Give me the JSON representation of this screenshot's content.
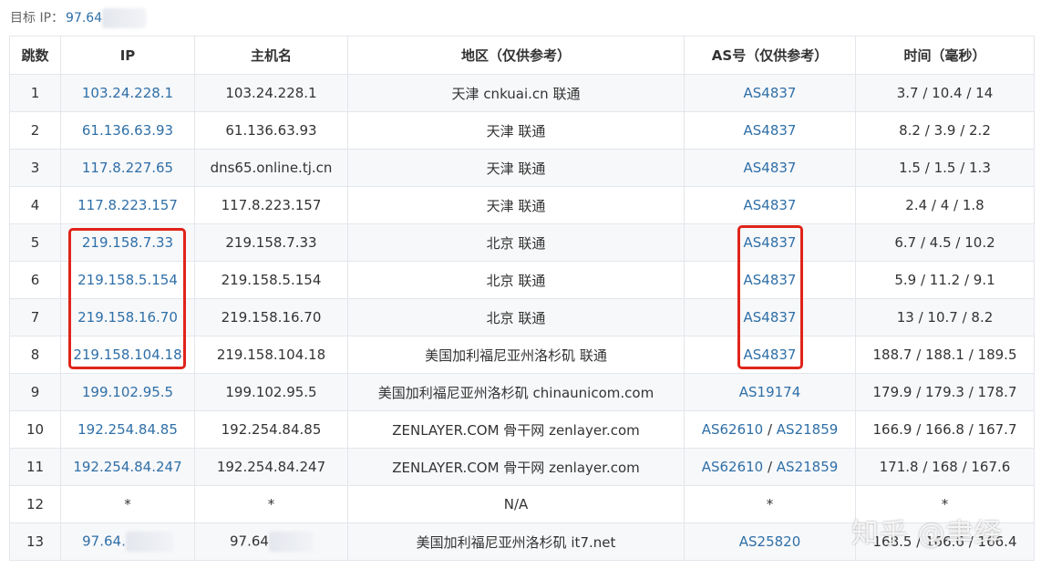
{
  "target": {
    "label": "目标 IP：",
    "ip_visible": "97.64"
  },
  "headers": [
    "跳数",
    "IP",
    "主机名",
    "地区（仅供参考）",
    "AS号（仅供参考）",
    "时间（毫秒）"
  ],
  "rows": [
    {
      "hop": "1",
      "ip": "103.24.228.1",
      "host": "103.24.228.1",
      "region": "天津 cnkuai.cn 联通",
      "as": [
        "AS4837"
      ],
      "time": "3.7 / 10.4 / 14"
    },
    {
      "hop": "2",
      "ip": "61.136.63.93",
      "host": "61.136.63.93",
      "region": "天津 联通",
      "as": [
        "AS4837"
      ],
      "time": "8.2 / 3.9 / 2.2"
    },
    {
      "hop": "3",
      "ip": "117.8.227.65",
      "host": "dns65.online.tj.cn",
      "region": "天津 联通",
      "as": [
        "AS4837"
      ],
      "time": "1.5 / 1.5 / 1.3"
    },
    {
      "hop": "4",
      "ip": "117.8.223.157",
      "host": "117.8.223.157",
      "region": "天津 联通",
      "as": [
        "AS4837"
      ],
      "time": "2.4 / 4 / 1.8"
    },
    {
      "hop": "5",
      "ip": "219.158.7.33",
      "host": "219.158.7.33",
      "region": "北京 联通",
      "as": [
        "AS4837"
      ],
      "time": "6.7 / 4.5 / 10.2"
    },
    {
      "hop": "6",
      "ip": "219.158.5.154",
      "host": "219.158.5.154",
      "region": "北京 联通",
      "as": [
        "AS4837"
      ],
      "time": "5.9 / 11.2 / 9.1"
    },
    {
      "hop": "7",
      "ip": "219.158.16.70",
      "host": "219.158.16.70",
      "region": "北京 联通",
      "as": [
        "AS4837"
      ],
      "time": "13 / 10.7 / 8.2"
    },
    {
      "hop": "8",
      "ip": "219.158.104.18",
      "host": "219.158.104.18",
      "region": "美国加利福尼亚州洛杉矶 联通",
      "as": [
        "AS4837"
      ],
      "time": "188.7 / 188.1 / 189.5"
    },
    {
      "hop": "9",
      "ip": "199.102.95.5",
      "host": "199.102.95.5",
      "region": "美国加利福尼亚州洛杉矶 chinaunicom.com",
      "as": [
        "AS19174"
      ],
      "time": "179.9 / 179.3 / 178.7"
    },
    {
      "hop": "10",
      "ip": "192.254.84.85",
      "host": "192.254.84.85",
      "region": "ZENLAYER.COM 骨干网 zenlayer.com",
      "as": [
        "AS62610",
        "AS21859"
      ],
      "time": "166.9 / 166.8 / 167.7"
    },
    {
      "hop": "11",
      "ip": "192.254.84.247",
      "host": "192.254.84.247",
      "region": "ZENLAYER.COM 骨干网 zenlayer.com",
      "as": [
        "AS62610",
        "AS21859"
      ],
      "time": "171.8 / 168 / 167.6"
    },
    {
      "hop": "12",
      "ip": "*",
      "host": "*",
      "region": "N/A",
      "as": [
        "*"
      ],
      "time": "*",
      "plain": true
    },
    {
      "hop": "13",
      "ip": "97.64.",
      "host": "97.64",
      "region": "美国加利福尼亚州洛杉矶 it7.net",
      "as": [
        "AS25820"
      ],
      "time": "168.5 / 166.6 / 166.4",
      "redacted": true
    }
  ],
  "as_separator": " / ",
  "watermark": "知乎 @聿绎",
  "colors": {
    "link": "#2f6fa7",
    "highlight_box": "#e0241b",
    "border": "#e3e6eb",
    "stripe": "#f7f8fa"
  }
}
